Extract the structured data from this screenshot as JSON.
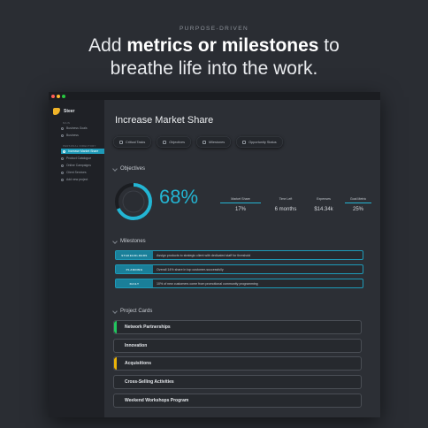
{
  "hero": {
    "eyebrow": "PURPOSE-DRIVEN",
    "headline_pre": "Add ",
    "headline_bold": "metrics or milestones",
    "headline_post": " to",
    "headline_line2": "breathe life into the work."
  },
  "window": {
    "dots": [
      "#ff5f57",
      "#febc2e",
      "#28c840"
    ]
  },
  "sidebar": {
    "brand": "Steer",
    "section1": "MAIN",
    "items1": [
      "Business Goals",
      "Business"
    ],
    "section2": "PERSONAL DIRECTORY",
    "items2": [
      {
        "label": "Increase Market Share",
        "active": true
      },
      {
        "label": "Product Catalogue",
        "active": false
      },
      {
        "label": "Online Campaigns",
        "active": false
      },
      {
        "label": "Client Services",
        "active": false
      },
      {
        "label": "Add new project",
        "active": false
      }
    ]
  },
  "main": {
    "title": "Increase Market Share",
    "tabs": [
      "Critical Tasks",
      "Objectives",
      "Milestones",
      "Opportunity Status"
    ],
    "objectives_label": "Objectives",
    "progress_percent": 68,
    "progress_text": "68%",
    "metrics": [
      {
        "label": "Market Share",
        "value": "17%",
        "color": "#23b5d3",
        "fill": 1.0
      },
      {
        "label": "Time Left",
        "value": "6 months",
        "color": "",
        "fill": 0
      },
      {
        "label": "Expenses",
        "value": "$14.34k",
        "color": "",
        "fill": 0
      },
      {
        "label": "Goal Metric",
        "value": "25%",
        "color": "#23b5d3",
        "fill": 1.0
      }
    ],
    "milestones_label": "Milestones",
    "milestones": [
      {
        "tag": "STAKEHOLDERS",
        "text": "Assign products to strategic client with dedicated staff for threshold"
      },
      {
        "tag": "PLANNING",
        "text": "Overall 14% share in top customer-successfully"
      },
      {
        "tag": "DAILY",
        "text": "10% of new customers come from promotional community programming"
      }
    ],
    "cards_label": "Project Cards",
    "cards": [
      {
        "label": "Network Partnerships",
        "accent": "#22c55e"
      },
      {
        "label": "Innovation",
        "accent": ""
      },
      {
        "label": "Acquisitions",
        "accent": "#eab308"
      },
      {
        "label": "Cross-Selling Activities",
        "accent": ""
      },
      {
        "label": "Weekend Workshops Program",
        "accent": ""
      }
    ]
  },
  "colors": {
    "accent": "#23b5d3",
    "sidebar_active": "#1e9ab8"
  }
}
